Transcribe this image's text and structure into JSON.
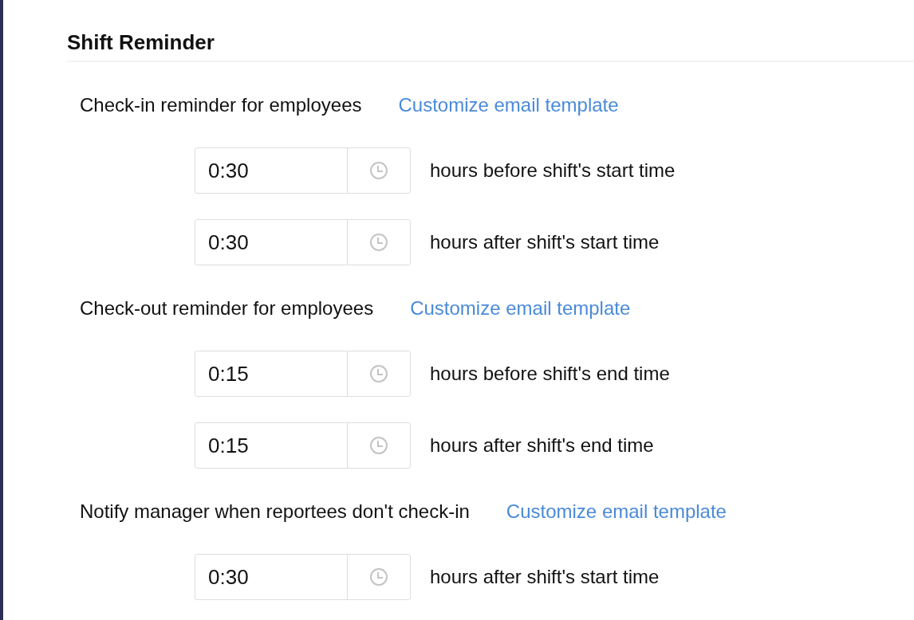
{
  "title": "Shift Reminder",
  "sections": [
    {
      "label": "Check-in reminder for employees",
      "link": "Customize email template",
      "fields": [
        {
          "value": "0:30",
          "description": "hours before shift's start time"
        },
        {
          "value": "0:30",
          "description": "hours after shift's start time"
        }
      ]
    },
    {
      "label": "Check-out reminder for employees",
      "link": "Customize email template",
      "fields": [
        {
          "value": "0:15",
          "description": "hours before shift's end time"
        },
        {
          "value": "0:15",
          "description": "hours after shift's end time"
        }
      ]
    },
    {
      "label": "Notify manager when reportees don't check-in",
      "link": "Customize email template",
      "fields": [
        {
          "value": "0:30",
          "description": "hours after shift's start time"
        }
      ]
    }
  ]
}
